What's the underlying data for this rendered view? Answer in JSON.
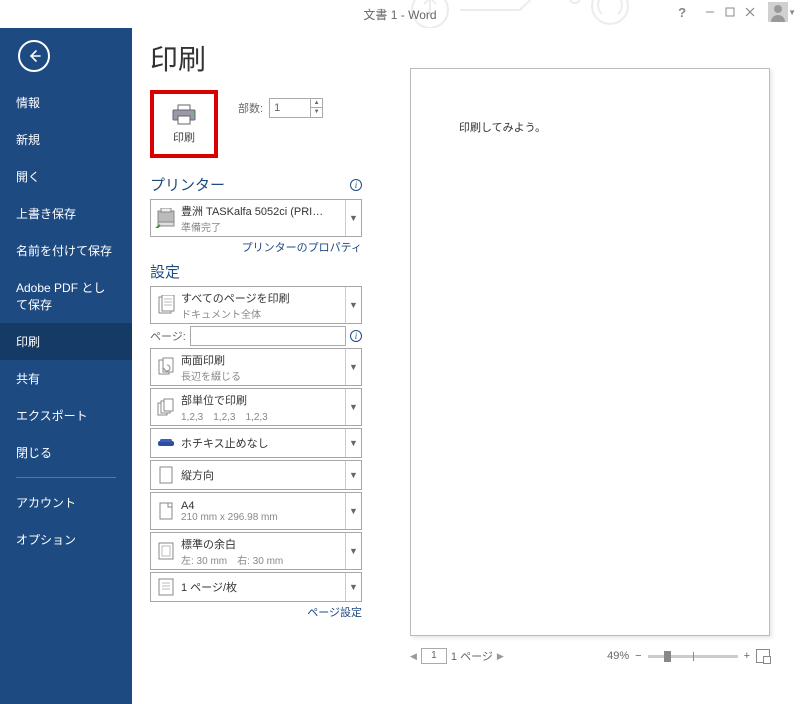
{
  "titlebar": {
    "title": "文書 1 - Word"
  },
  "sidebar": {
    "items": [
      {
        "label": "情報"
      },
      {
        "label": "新規"
      },
      {
        "label": "開く"
      },
      {
        "label": "上書き保存"
      },
      {
        "label": "名前を付けて保存"
      },
      {
        "label": "Adobe PDF として保存"
      },
      {
        "label": "印刷"
      },
      {
        "label": "共有"
      },
      {
        "label": "エクスポート"
      },
      {
        "label": "閉じる"
      }
    ],
    "footer": [
      {
        "label": "アカウント"
      },
      {
        "label": "オプション"
      }
    ]
  },
  "page_title": "印刷",
  "print_button_label": "印刷",
  "copies": {
    "label": "部数:",
    "value": "1"
  },
  "printer_section": "プリンター",
  "printer": {
    "name": "豊洲 TASKalfa 5052ci (PRI…",
    "status": "準備完了"
  },
  "printer_properties": "プリンターのプロパティ",
  "settings_section": "設定",
  "settings": {
    "print_range": {
      "l1": "すべてのページを印刷",
      "l2": "ドキュメント全体"
    },
    "pages_label": "ページ:",
    "pages_value": "",
    "duplex": {
      "l1": "両面印刷",
      "l2": "長辺を綴じる"
    },
    "collate": {
      "l1": "部単位で印刷",
      "l2": "1,2,3　1,2,3　1,2,3"
    },
    "staple": {
      "l1": "ホチキス止めなし"
    },
    "orientation": {
      "l1": "縦方向"
    },
    "paper": {
      "l1": "A4",
      "l2": "210 mm x 296.98 mm"
    },
    "margins": {
      "l1": "標準の余白",
      "l2": "左: 30 mm　右: 30 mm"
    },
    "per_sheet": {
      "l1": "1 ページ/枚"
    }
  },
  "page_setup": "ページ設定",
  "preview": {
    "text": "印刷してみよう。",
    "current_page": "1",
    "total_label": "1 ページ",
    "zoom": "49%"
  }
}
